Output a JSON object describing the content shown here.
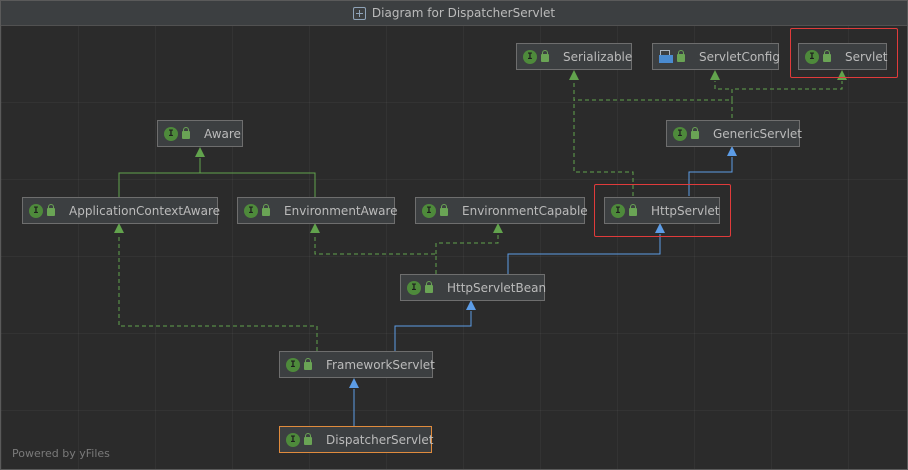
{
  "window": {
    "title": "Diagram for DispatcherServlet",
    "title_icon": "diagram-icon",
    "footer": "Powered by yFiles"
  },
  "nodes": {
    "serializable": {
      "label": "Serializable",
      "icon": "interface-icon",
      "badge": "I"
    },
    "servlet_config": {
      "label": "ServletConfig",
      "icon": "config-file-icon"
    },
    "servlet": {
      "label": "Servlet",
      "icon": "interface-icon",
      "badge": "I",
      "highlighted": true
    },
    "aware": {
      "label": "Aware",
      "icon": "interface-icon",
      "badge": "I"
    },
    "generic_servlet": {
      "label": "GenericServlet",
      "icon": "class-icon",
      "badge": "I"
    },
    "application_context_aware": {
      "label": "ApplicationContextAware",
      "icon": "interface-icon",
      "badge": "I"
    },
    "environment_aware": {
      "label": "EnvironmentAware",
      "icon": "interface-icon",
      "badge": "I"
    },
    "environment_capable": {
      "label": "EnvironmentCapable",
      "icon": "interface-icon",
      "badge": "I"
    },
    "http_servlet": {
      "label": "HttpServlet",
      "icon": "class-icon",
      "badge": "I",
      "highlighted": true
    },
    "http_servlet_bean": {
      "label": "HttpServletBean",
      "icon": "class-icon",
      "badge": "I"
    },
    "framework_servlet": {
      "label": "FrameworkServlet",
      "icon": "class-icon",
      "badge": "I"
    },
    "dispatcher_servlet": {
      "label": "DispatcherServlet",
      "icon": "class-icon",
      "badge": "I",
      "focused": true
    }
  },
  "edges": [
    {
      "from": "generic_servlet",
      "to": "serializable",
      "kind": "implements"
    },
    {
      "from": "generic_servlet",
      "to": "servlet_config",
      "kind": "implements"
    },
    {
      "from": "generic_servlet",
      "to": "servlet",
      "kind": "implements"
    },
    {
      "from": "http_servlet",
      "to": "serializable",
      "kind": "implements"
    },
    {
      "from": "http_servlet",
      "to": "generic_servlet",
      "kind": "extends"
    },
    {
      "from": "application_context_aware",
      "to": "aware",
      "kind": "extends-interface"
    },
    {
      "from": "environment_aware",
      "to": "aware",
      "kind": "extends-interface"
    },
    {
      "from": "http_servlet_bean",
      "to": "http_servlet",
      "kind": "extends"
    },
    {
      "from": "http_servlet_bean",
      "to": "environment_aware",
      "kind": "implements"
    },
    {
      "from": "http_servlet_bean",
      "to": "environment_capable",
      "kind": "implements"
    },
    {
      "from": "framework_servlet",
      "to": "http_servlet_bean",
      "kind": "extends"
    },
    {
      "from": "framework_servlet",
      "to": "application_context_aware",
      "kind": "implements"
    },
    {
      "from": "dispatcher_servlet",
      "to": "framework_servlet",
      "kind": "extends"
    }
  ],
  "colors": {
    "background": "#2b2b2b",
    "node_fill": "#3c3f41",
    "node_border": "#6e6e6e",
    "focus_border": "#e08b3d",
    "highlight_red": "#e03b3b",
    "extends_blue": "#5c9ce6",
    "implements_green": "#62a34d",
    "interface_badge": "#4e8a3b"
  }
}
